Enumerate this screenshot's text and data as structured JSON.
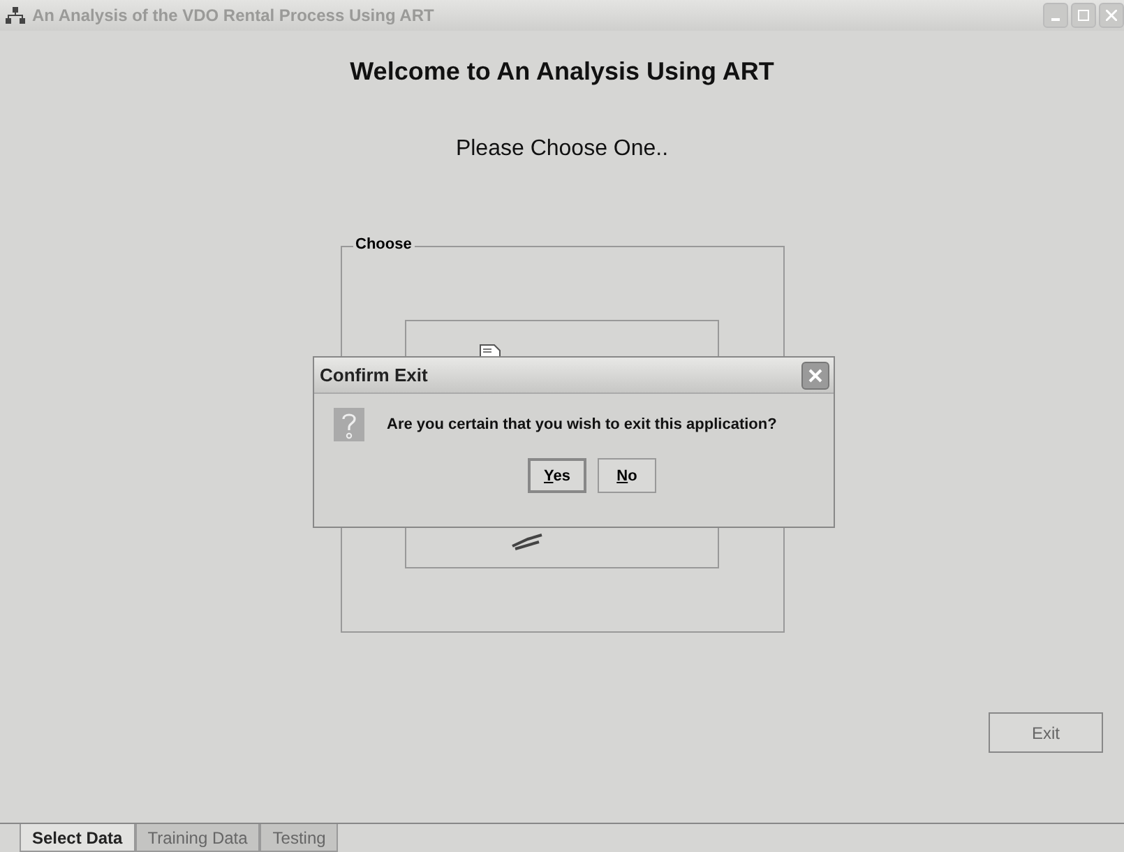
{
  "window": {
    "title": "An Analysis of the VDO Rental Process Using ART"
  },
  "heading": "Welcome to An Analysis Using ART",
  "subheading": "Please Choose One..",
  "group": {
    "title": "Choose"
  },
  "exit_button": "Exit",
  "tabs": [
    {
      "label": "Select Data",
      "selected": true,
      "disabled": false
    },
    {
      "label": "Training Data",
      "selected": false,
      "disabled": true
    },
    {
      "label": "Testing",
      "selected": false,
      "disabled": true
    }
  ],
  "dialog": {
    "title": "Confirm Exit",
    "message": "Are you certain that you wish to exit this application?",
    "buttons": [
      {
        "label": "Yes",
        "focused": true
      },
      {
        "label": "No",
        "focused": false
      }
    ]
  }
}
